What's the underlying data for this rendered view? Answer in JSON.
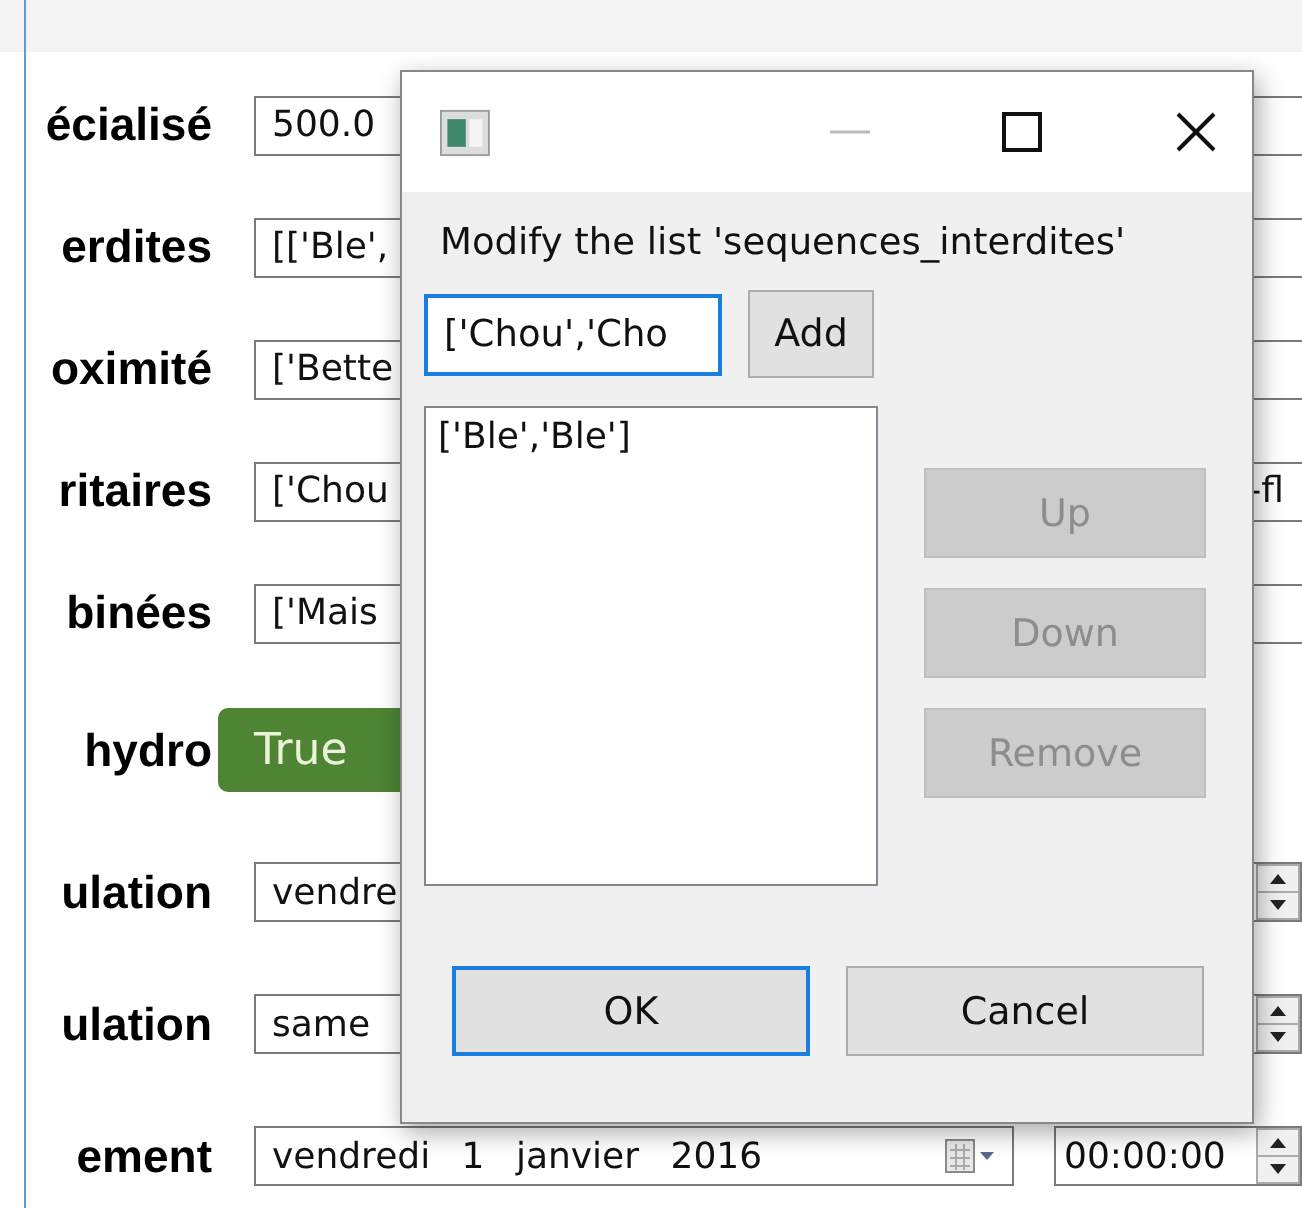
{
  "form": {
    "rows": [
      {
        "kind": "text",
        "label": "écialisé",
        "value": "500.0"
      },
      {
        "kind": "text",
        "label": "erdites",
        "value": "[['Ble',"
      },
      {
        "kind": "text",
        "label": "oximité",
        "value": "['Bette"
      },
      {
        "kind": "text",
        "label": "ritaires",
        "value": "['Chou",
        "value_tail": "-fl"
      },
      {
        "kind": "text",
        "label": "binées",
        "value": "['Mais"
      },
      {
        "kind": "toggle",
        "label": "hydro",
        "value": "True",
        "on": true
      },
      {
        "kind": "datetime",
        "label": "ulation",
        "date": "vendre"
      },
      {
        "kind": "datetime",
        "label": "ulation",
        "date": "same"
      },
      {
        "kind": "datetime",
        "label": "ement",
        "date": "vendredi 1 janvier 2016",
        "time": "00:00:00"
      }
    ]
  },
  "dialog": {
    "message": "Modify the list 'sequences_interdites'",
    "input": {
      "value": "['Chou','Cho"
    },
    "add_button": "Add",
    "items": [
      {
        "text": "['Ble','Ble']",
        "selected": false
      }
    ],
    "side_buttons": [
      {
        "label": "Up",
        "disabled": true
      },
      {
        "label": "Down",
        "disabled": true
      },
      {
        "label": "Remove",
        "disabled": true
      }
    ],
    "ok": "OK",
    "cancel": "Cancel"
  }
}
